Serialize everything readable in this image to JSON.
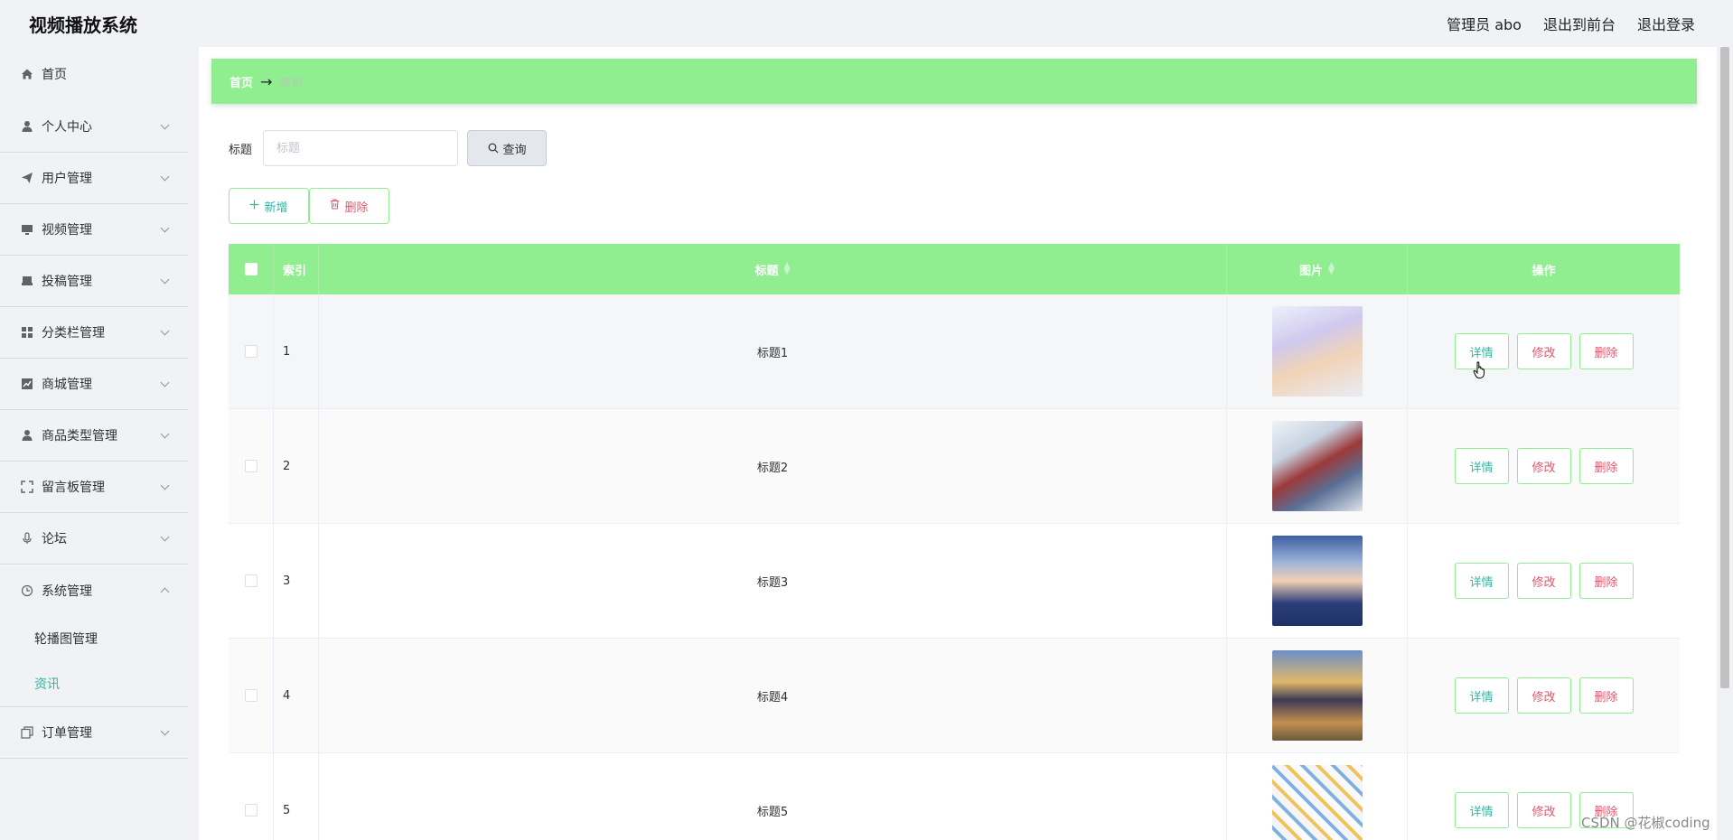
{
  "app": {
    "title": "视频播放系统"
  },
  "header": {
    "user": "管理员 abo",
    "to_front": "退出到前台",
    "logout": "退出登录"
  },
  "sidebar": {
    "items": [
      {
        "label": "首页",
        "icon": "home-icon"
      },
      {
        "label": "个人中心",
        "icon": "user-icon"
      },
      {
        "label": "用户管理",
        "icon": "send-icon"
      },
      {
        "label": "视频管理",
        "icon": "monitor-icon"
      },
      {
        "label": "投稿管理",
        "icon": "printer-icon"
      },
      {
        "label": "分类栏管理",
        "icon": "grid-icon"
      },
      {
        "label": "商城管理",
        "icon": "chart-icon"
      },
      {
        "label": "商品类型管理",
        "icon": "user-icon"
      },
      {
        "label": "留言板管理",
        "icon": "fullscreen-icon"
      },
      {
        "label": "论坛",
        "icon": "microphone-icon"
      },
      {
        "label": "系统管理",
        "icon": "clock-icon"
      },
      {
        "label": "订单管理",
        "icon": "copy-icon"
      }
    ],
    "system_sub": [
      {
        "label": "轮播图管理"
      },
      {
        "label": "资讯"
      }
    ]
  },
  "breadcrumb": {
    "home": "首页",
    "separator": "→",
    "current": "资讯"
  },
  "search": {
    "label": "标题",
    "placeholder": "标题",
    "button": "查询"
  },
  "actions": {
    "add": "新增",
    "delete": "删除"
  },
  "table": {
    "headers": {
      "index": "索引",
      "title": "标题",
      "image": "图片",
      "ops": "操作"
    },
    "rows": [
      {
        "index": "1",
        "title": "标题1"
      },
      {
        "index": "2",
        "title": "标题2"
      },
      {
        "index": "3",
        "title": "标题3"
      },
      {
        "index": "4",
        "title": "标题4"
      },
      {
        "index": "5",
        "title": "标题5"
      }
    ],
    "row_actions": {
      "detail": "详情",
      "edit": "修改",
      "delete": "删除"
    }
  },
  "watermark": "CSDN @花椒coding",
  "colors": {
    "accent_green": "#90ee90",
    "teal_text": "#2db7a4",
    "danger_text": "#e0566b"
  }
}
